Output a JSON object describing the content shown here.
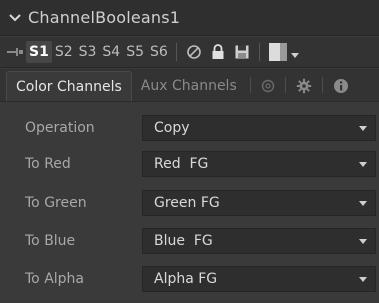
{
  "node": {
    "title": "ChannelBooleans1"
  },
  "toolbar": {
    "slots": [
      "S1",
      "S2",
      "S3",
      "S4",
      "S5",
      "S6"
    ],
    "active_slot": "S1"
  },
  "tabs": [
    {
      "label": "Color Channels",
      "active": true
    },
    {
      "label": "Aux Channels",
      "active": false
    }
  ],
  "fields": [
    {
      "label": "Operation",
      "value": "Copy"
    },
    {
      "label": "To Red",
      "value": "Red  FG"
    },
    {
      "label": "To Green",
      "value": "Green FG"
    },
    {
      "label": "To Blue",
      "value": "Blue  FG"
    },
    {
      "label": "To Alpha",
      "value": "Alpha FG"
    }
  ],
  "icons": {
    "collapse": "chevron-down-icon",
    "pin": "pin-icon",
    "disable": "disable-icon",
    "lock": "lock-icon",
    "save": "save-icon",
    "color": "color-swatch-icon",
    "tab_image": "image-icon",
    "tab_settings": "gear-icon",
    "tab_info": "info-icon"
  },
  "colors": {
    "background": "#3a3a3a",
    "combo_bg": "#2e2e2e",
    "label_text": "#a8a8a8",
    "value_text": "#d9d9d9"
  }
}
